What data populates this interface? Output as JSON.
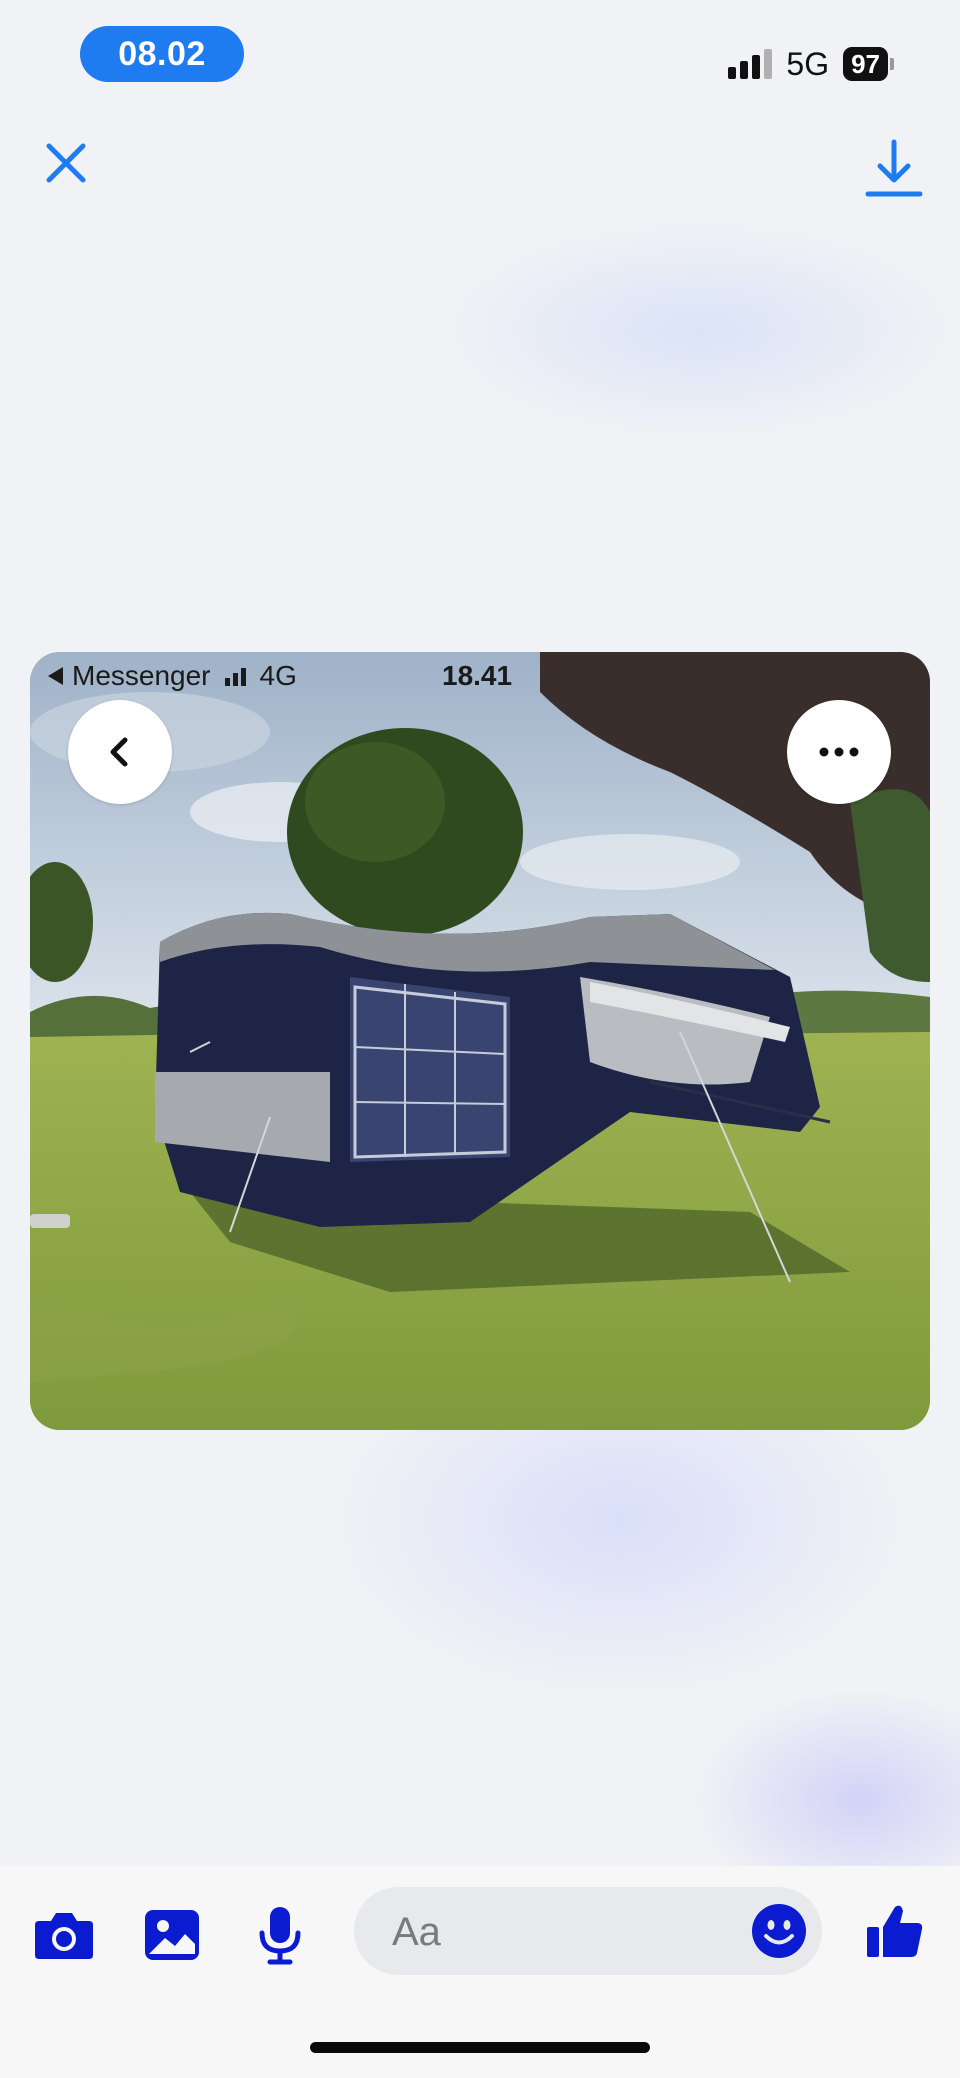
{
  "status_bar": {
    "time": "08.02",
    "network": "5G",
    "battery": "97"
  },
  "top_bar": {
    "close_icon": "close-icon",
    "download_icon": "download-icon"
  },
  "photo": {
    "embedded_status": {
      "back_app": "Messenger",
      "network": "4G",
      "time": "18.41"
    },
    "back_button_icon": "chevron-left-icon",
    "more_button_icon": "more-horizontal-icon"
  },
  "composer": {
    "placeholder": "Aa",
    "icons": [
      "camera-icon",
      "gallery-icon",
      "microphone-icon",
      "emoji-icon",
      "thumbs-up-icon"
    ]
  },
  "colors": {
    "accent": "#1f7cf0",
    "composer_icon": "#0a1bd0"
  }
}
